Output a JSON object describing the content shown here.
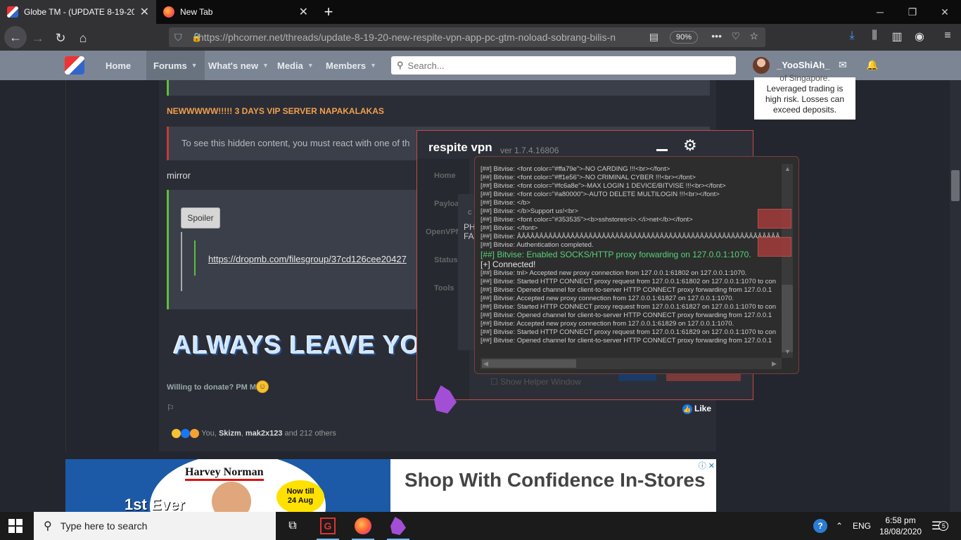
{
  "browser": {
    "tabs": [
      {
        "title": "Globe TM - (UPDATE 8-19-20)",
        "active": true
      },
      {
        "title": "New Tab",
        "active": false
      }
    ],
    "url": "https://phcorner.net/threads/update-8-19-20-new-respite-vpn-app-pc-gtm-noload-sobrang-bilis-n",
    "zoom": "90%"
  },
  "site": {
    "nav": [
      "Home",
      "Forums",
      "What's new",
      "Media",
      "Members"
    ],
    "search_placeholder": "Search...",
    "username": "_YooShiAh_"
  },
  "post": {
    "headline": "NEWWWWW!!!!! 3 DAYS VIP SERVER NAPAKALAKAS",
    "hidden_notice": "To see this hidden content, you must react with one of th",
    "mirror": "mirror",
    "spoiler": "Spoiler",
    "link": "https://dropmb.com/filesgroup/37cd126cee20427",
    "banner": "ALWAYS LEAVE YO",
    "donate": "Willing to donate? PM ME",
    "like": "Like",
    "reactions_prefix": "You, ",
    "reactions_user1": "Skizm",
    "reactions_sep": ", ",
    "reactions_user2": "mak2x123",
    "reactions_suffix": " and 212 others"
  },
  "side_ad": {
    "line1": "of Singapore.",
    "line2": "Leveraged trading is",
    "line3": "high risk. Losses can",
    "line4": "exceed deposits."
  },
  "ad": {
    "brand": "Harvey Norman",
    "first_ever": "1st Ever",
    "badge_line1": "Now till",
    "badge_line2": "24 Aug",
    "headline": "Shop With Confidence In-Stores"
  },
  "vpn": {
    "title": "respite vpn",
    "version": "ver 1.7.4.16806",
    "nav": [
      "Home",
      "Payload",
      "OpenVPN",
      "Status",
      "Tools"
    ],
    "c_label": "c",
    "ph_line1": "PH",
    "ph_line2": "FA",
    "show_helper": "Show Helper Window",
    "log": [
      "[##] Bitvise: <font color=\"#ffa79e\">-NO CARDING !!!<br></font>",
      "[##] Bitvise: <font color=\"#ff1e56\">-NO CRIMINAL CYBER !!!<br></font>",
      "[##] Bitvise: <font color=\"#fc6a8e\">-MAX LOGIN 1 DEVICE/BITVISE !!!<br></font>",
      "[##] Bitvise: <font color=\"#a80000\">-AUTO DELETE MULTILOGIN !!!<br></font>",
      "[##] Bitvise: </b>",
      "[##] Bitvise: </b>Support us!<br>",
      "[##] Bitvise: <font color=\"#353535\"><b>sshstores<i>.</i>net</b></font>",
      "[##] Bitvise: </font>",
      "[##] Bitvise: ÂÂÂÂÂÂÂÂÂÂÂÂÂÂÂÂÂÂÂÂÂÂÂÂÂÂÂÂÂÂÂÂÂÂÂÂÂÂÂÂÂÂÂÂÂÂÂÂÂÂÂÂÂÂÂÂÂÂÂÂÂÂ",
      "[##] Bitvise: Authentication completed."
    ],
    "log_green": "[##] Bitvise: Enabled SOCKS/HTTP proxy forwarding on 127.0.0.1:1070.",
    "log_connected": "[+] Connected!",
    "log_tail": [
      "[##] Bitvise: tnl> Accepted new proxy connection from 127.0.0.1:61802 on 127.0.0.1:1070.",
      "[##] Bitvise: Started HTTP CONNECT proxy request from 127.0.0.1:61802 on 127.0.0.1:1070 to con",
      "[##] Bitvise: Opened channel for client-to-server HTTP CONNECT proxy forwarding from 127.0.0.1",
      "[##] Bitvise: Accepted new proxy connection from 127.0.0.1:61827 on 127.0.0.1:1070.",
      "[##] Bitvise: Started HTTP CONNECT proxy request from 127.0.0.1:61827 on 127.0.0.1:1070 to con",
      "[##] Bitvise: Opened channel for client-to-server HTTP CONNECT proxy forwarding from 127.0.0.1",
      "[##] Bitvise: Accepted new proxy connection from 127.0.0.1:61829 on 127.0.0.1:1070.",
      "[##] Bitvise: Started HTTP CONNECT proxy request from 127.0.0.1:61829 on 127.0.0.1:1070 to con",
      "[##] Bitvise: Opened channel for client-to-server HTTP CONNECT proxy forwarding from 127.0.0.1"
    ]
  },
  "taskbar": {
    "search_placeholder": "Type here to search",
    "language": "ENG",
    "time": "6:58 pm",
    "date": "18/08/2020",
    "notifications": "5"
  }
}
